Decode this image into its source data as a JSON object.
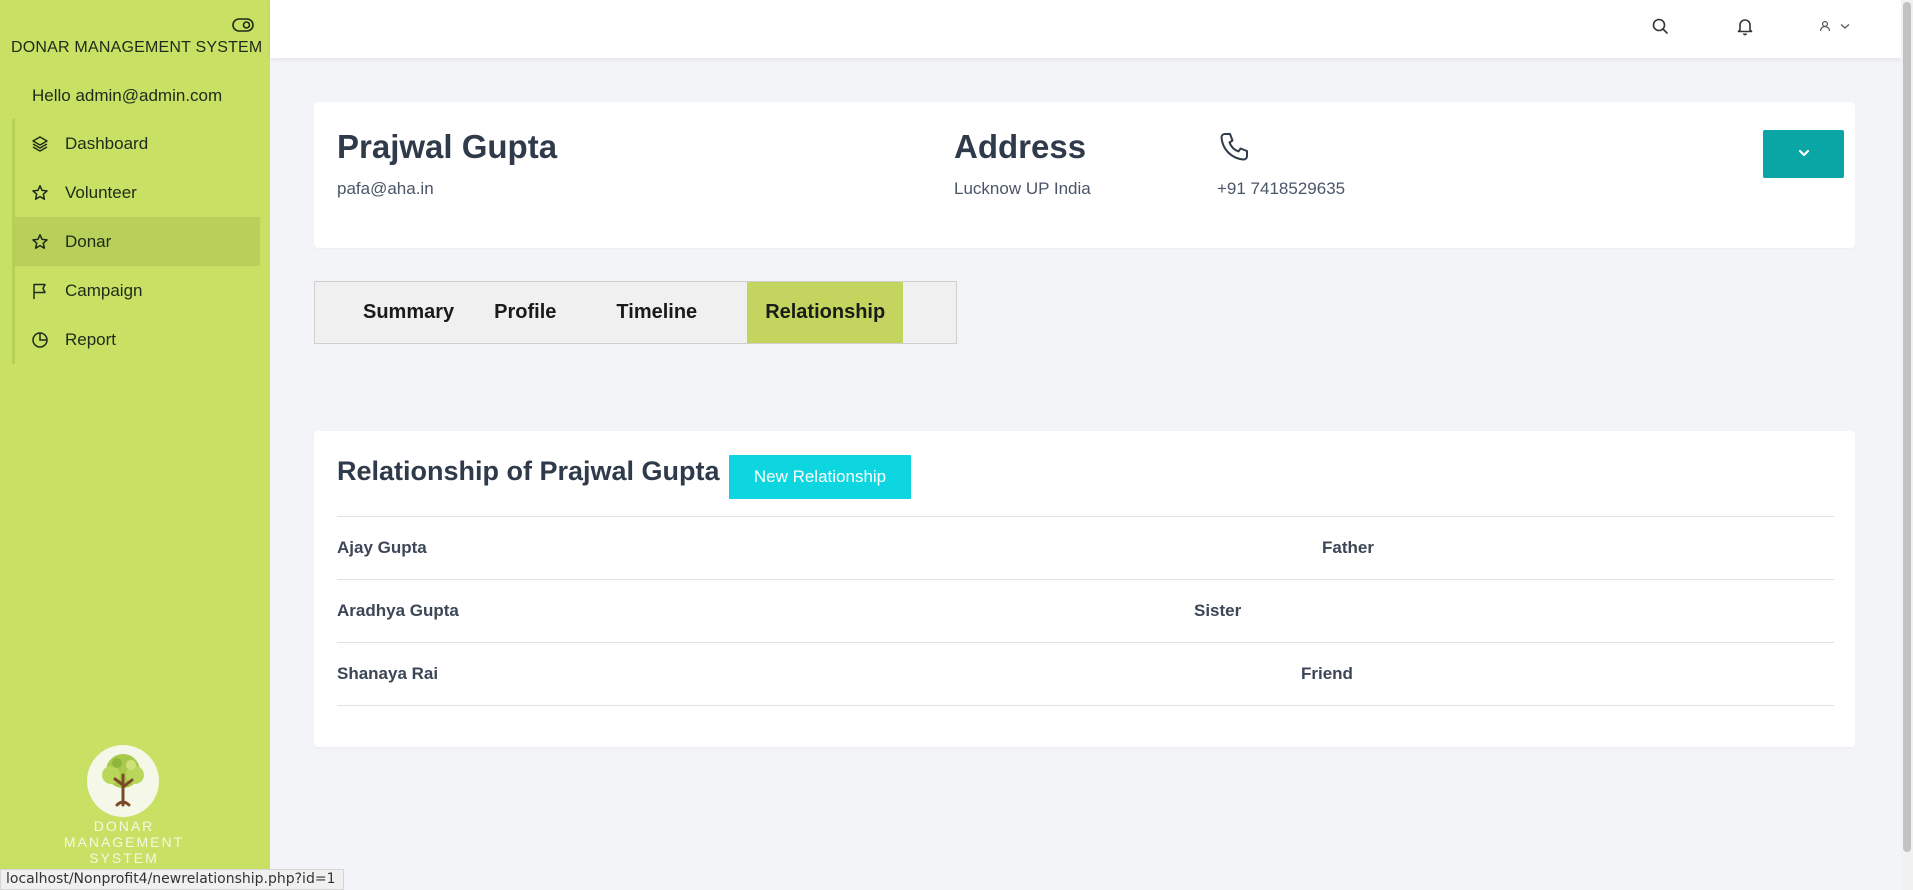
{
  "app": {
    "brand": "DONAR MANAGEMENT SYSTEM",
    "greeting": "Hello admin@admin.com",
    "logo_text_line1": "DONAR",
    "logo_text_line2": "MANAGEMENT",
    "logo_text_line3": "SYSTEM"
  },
  "sidebar": {
    "items": [
      {
        "label": "Dashboard",
        "icon": "layers-icon",
        "active": false
      },
      {
        "label": "Volunteer",
        "icon": "star-icon",
        "active": false
      },
      {
        "label": "Donar",
        "icon": "star-icon",
        "active": true
      },
      {
        "label": "Campaign",
        "icon": "flag-icon",
        "active": false
      },
      {
        "label": "Report",
        "icon": "pie-chart-icon",
        "active": false
      }
    ]
  },
  "topbar": {
    "icons": [
      "search-icon",
      "bell-icon",
      "user-icon",
      "chevron-down-icon"
    ]
  },
  "profile": {
    "name": "Prajwal Gupta",
    "email": "pafa@aha.in",
    "address_title": "Address",
    "address": "Lucknow UP India",
    "phone": "+91 7418529635"
  },
  "tabs": [
    {
      "label": "Summary",
      "active": false
    },
    {
      "label": "Profile",
      "active": false
    },
    {
      "label": "Timeline",
      "active": false
    },
    {
      "label": "Relationship",
      "active": true
    }
  ],
  "relationships": {
    "title": "Relationship of Prajwal Gupta",
    "new_button": "New Relationship",
    "rows": [
      {
        "name": "Ajay Gupta",
        "relation": "Father"
      },
      {
        "name": "Aradhya Gupta",
        "relation": "Sister"
      },
      {
        "name": "Shanaya Rai",
        "relation": "Friend"
      }
    ]
  },
  "statusbar": {
    "url": "localhost/Nonprofit4/newrelationship.php?id=1"
  },
  "colors": {
    "sidebar": "#c8e064",
    "active_tab": "#c3d55f",
    "primary_button": "#0ed6e0",
    "dropdown_button": "#0aa5a5"
  }
}
